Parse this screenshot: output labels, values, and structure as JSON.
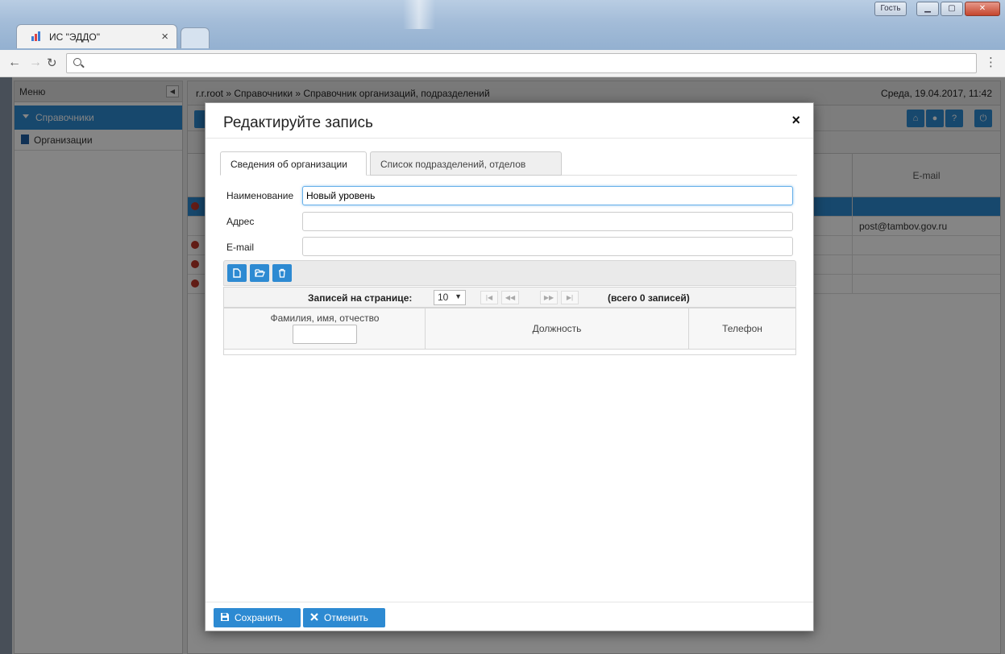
{
  "browser": {
    "tab_title": "ИС \"ЭДДО\"",
    "tab_close": "×",
    "guest_label": "Гость",
    "url_value": "",
    "menu_glyph": "⋮"
  },
  "sidebar": {
    "header": "Меню",
    "section": "Справочники",
    "items": [
      {
        "label": "Организации"
      }
    ]
  },
  "breadcrumb": {
    "text": "r.r.root » Справочники » Справочник организаций, подразделений",
    "date": "Среда, 19.04.2017, 11:42"
  },
  "grid": {
    "email_header": "E-mail",
    "rows": [
      {
        "email": ""
      },
      {
        "email": "post@tambov.gov.ru"
      },
      {
        "email": ""
      },
      {
        "email": ""
      },
      {
        "email": ""
      }
    ]
  },
  "modal": {
    "title": "Редактируйте запись",
    "close_glyph": "×",
    "tabs": [
      {
        "label": "Сведения об организации",
        "active": true
      },
      {
        "label": "Список подразделений, отделов",
        "active": false
      }
    ],
    "fields": {
      "name_label": "Наименование",
      "name_value": "Новый уровень",
      "address_label": "Адрес",
      "address_value": "",
      "email_label": "E-mail",
      "email_value": ""
    },
    "pager": {
      "per_page_label": "Записей на странице:",
      "page_size": "10",
      "total": "(всего 0 записей)"
    },
    "table": {
      "columns": [
        "Фамилия, имя, отчество",
        "Должность",
        "Телефон"
      ]
    },
    "footer": {
      "save": "Сохранить",
      "cancel": "Отменить"
    }
  },
  "colors": {
    "accent": "#2d8ad2",
    "overlay": "rgba(0,0,0,0.48)"
  }
}
